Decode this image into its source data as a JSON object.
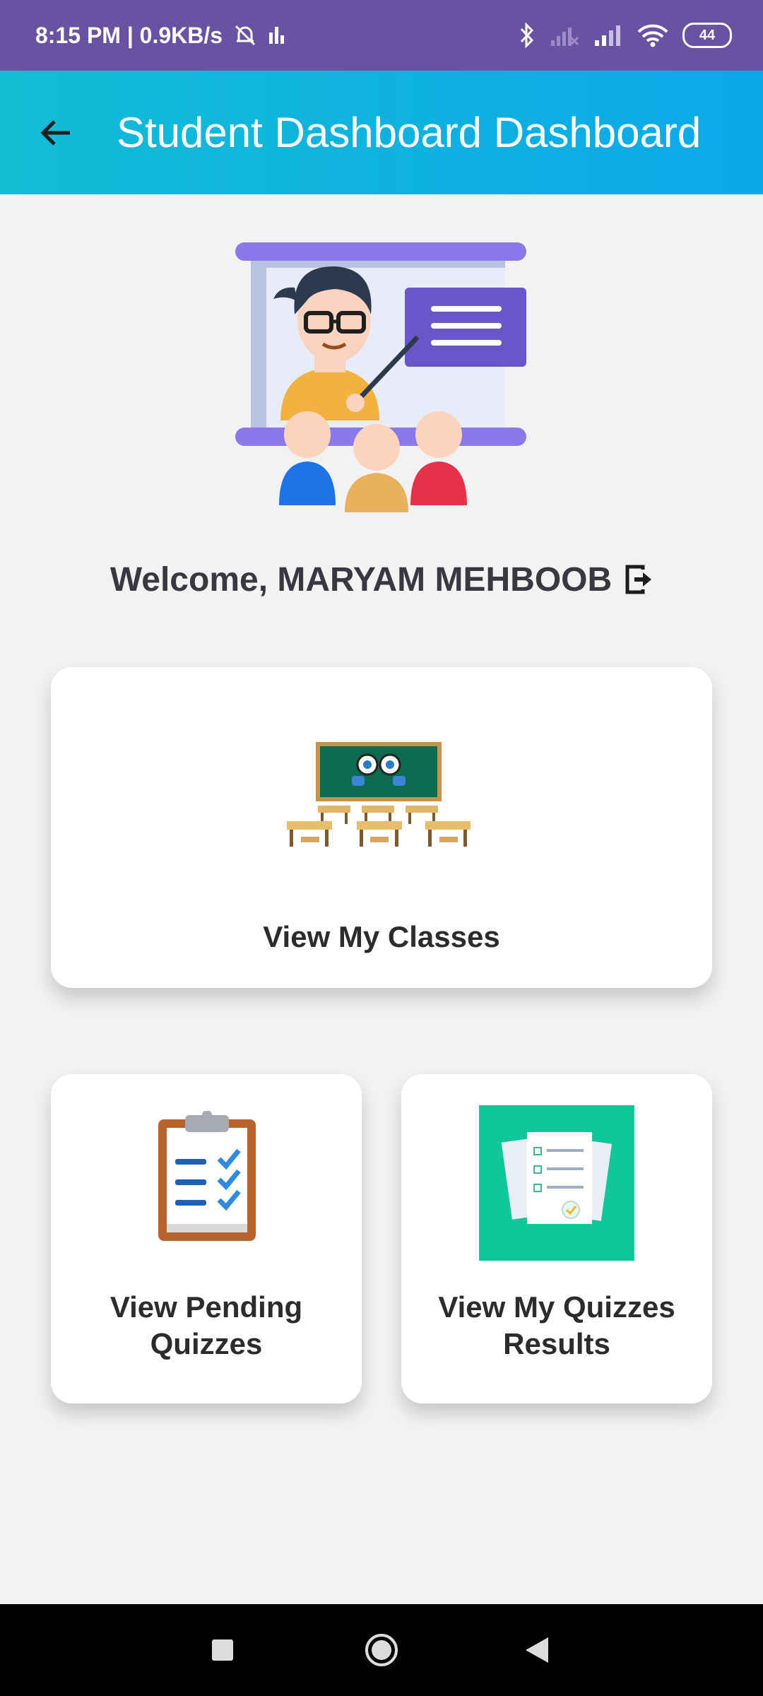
{
  "status_bar": {
    "time_info": "8:15 PM | 0.9KB/s",
    "battery": "44",
    "icons": [
      "alarm-off-icon",
      "activity-icon",
      "bluetooth-icon",
      "signal-no-sim-icon",
      "signal-icon",
      "wifi-icon",
      "battery-icon"
    ]
  },
  "app_bar": {
    "title": "Student Dashboard Dashboard",
    "back_icon": "arrow-left-icon"
  },
  "welcome": {
    "text": "Welcome, MARYAM MEHBOOB",
    "logout_icon": "logout-icon"
  },
  "cards": {
    "classes": {
      "label": "View My Classes",
      "icon": "classroom-icon"
    },
    "pending": {
      "label": "View Pending Quizzes",
      "icon": "clipboard-checklist-icon"
    },
    "results": {
      "label": "View My Quizzes Results",
      "icon": "result-documents-icon"
    }
  },
  "nav_bar": {
    "icons": [
      "recent-apps-icon",
      "home-icon",
      "back-icon"
    ]
  },
  "colors": {
    "status_bar": "#6a52a3",
    "app_bar_start": "#14bcd4",
    "app_bar_end": "#0aa9ea",
    "background": "#f2f2f2",
    "card": "#ffffff"
  }
}
